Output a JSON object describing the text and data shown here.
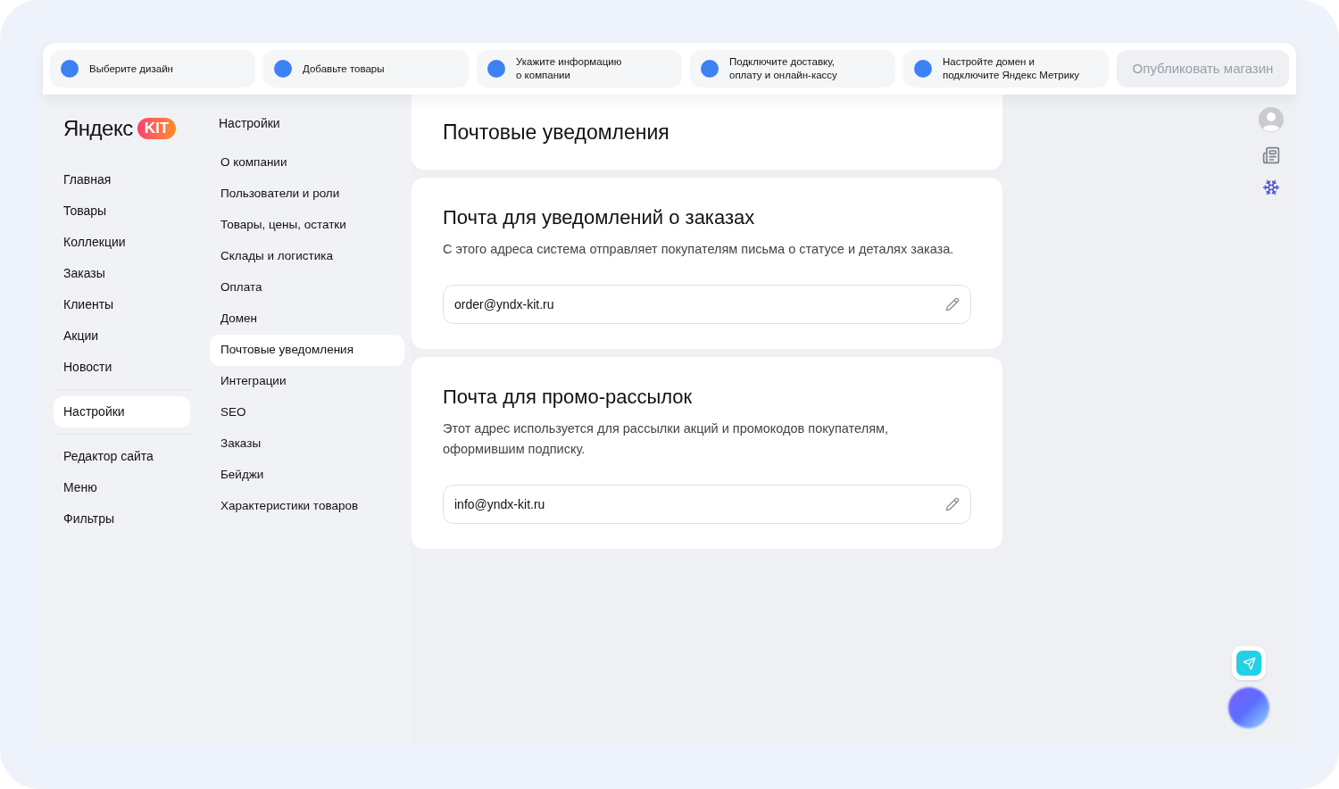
{
  "steps": [
    {
      "label": "Выберите дизайн",
      "color": "#3d82f5"
    },
    {
      "label": "Добавьте товары",
      "color": "#3d82f5"
    },
    {
      "label": "Укажите информацию\nо компании",
      "color": "#3d82f5"
    },
    {
      "label": "Подключите доставку,\nоплату и онлайн-кассу",
      "color": "#3d82f5"
    },
    {
      "label": "Настройте домен и\nподключите Яндекс Метрику",
      "color": "#3d82f5"
    }
  ],
  "publish_button": {
    "label": "Опубликовать магазин",
    "disabled": true
  },
  "logo": {
    "name": "Яндекс",
    "badge": "KIT"
  },
  "nav": {
    "groups": [
      [
        {
          "label": "Главная",
          "selected": false
        },
        {
          "label": "Товары",
          "selected": false
        },
        {
          "label": "Коллекции",
          "selected": false
        },
        {
          "label": "Заказы",
          "selected": false
        },
        {
          "label": "Клиенты",
          "selected": false
        },
        {
          "label": "Акции",
          "selected": false
        },
        {
          "label": "Новости",
          "selected": false
        }
      ],
      [
        {
          "label": "Настройки",
          "selected": true
        }
      ],
      [
        {
          "label": "Редактор сайта",
          "selected": false
        },
        {
          "label": "Меню",
          "selected": false
        },
        {
          "label": "Фильтры",
          "selected": false
        }
      ]
    ]
  },
  "submenu": {
    "title": "Настройки",
    "items": [
      {
        "label": "О компании",
        "selected": false
      },
      {
        "label": "Пользователи и роли",
        "selected": false
      },
      {
        "label": "Товары, цены, остатки",
        "selected": false
      },
      {
        "label": "Склады и логистика",
        "selected": false
      },
      {
        "label": "Оплата",
        "selected": false
      },
      {
        "label": "Домен",
        "selected": false
      },
      {
        "label": "Почтовые уведомления",
        "selected": true
      },
      {
        "label": "Интеграции",
        "selected": false
      },
      {
        "label": "SEO",
        "selected": false
      },
      {
        "label": "Заказы",
        "selected": false
      },
      {
        "label": "Бейджи",
        "selected": false
      },
      {
        "label": "Характеристики товаров",
        "selected": false
      }
    ]
  },
  "page_title": "Почтовые уведомления",
  "sections": [
    {
      "title": "Почта для уведомлений о заказах",
      "description": "С этого адреса система отправляет покупателям письма о статусе и деталях заказа.",
      "value": "order@yndx-kit.ru"
    },
    {
      "title": "Почта для промо-рассылок",
      "description": "Этот адрес используется для рассылки акций и промокодов покупателям, оформившим подписку.",
      "value": "info@yndx-kit.ru"
    }
  ]
}
